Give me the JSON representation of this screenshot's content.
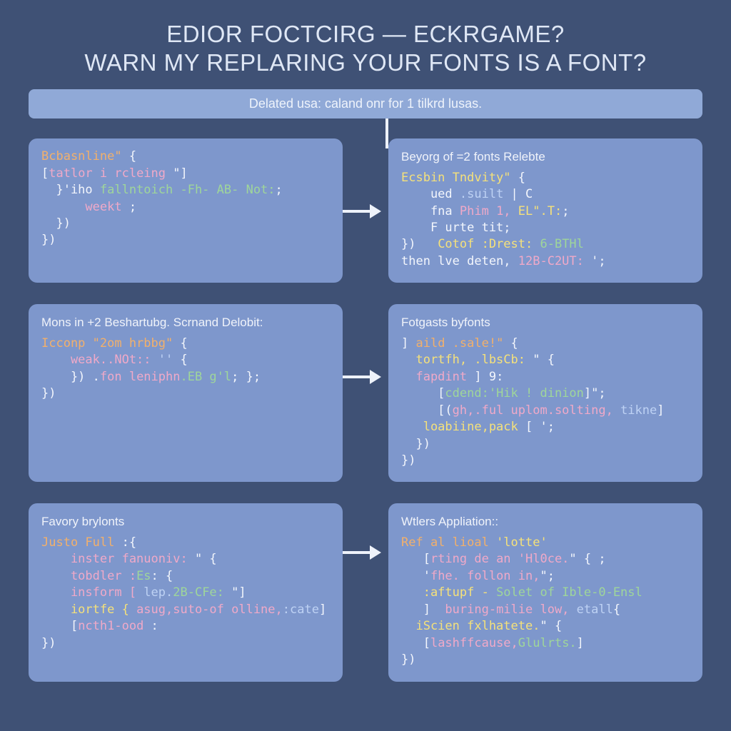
{
  "title": {
    "line1": "EDIOR FOCTCIRG — ECKRGAME?",
    "line2": "WARN MY REPLARING YOUR FONTS IS A FONT?"
  },
  "banner": "Delated usa: caland onr for 1 tilkrd lusas.",
  "cards": [
    {
      "title": "",
      "lines": [
        [
          {
            "c": "o",
            "t": "Bcbasnline\""
          },
          {
            "c": "w",
            "t": " {"
          }
        ],
        [
          {
            "c": "w",
            "t": "["
          },
          {
            "c": "p",
            "t": "tatlor i rcleing"
          },
          {
            "c": "w",
            "t": " \"]"
          }
        ],
        [
          {
            "c": "w",
            "t": "  }'iho "
          },
          {
            "c": "g",
            "t": "fallntoich -Fh- AB- Not:"
          },
          {
            "c": "w",
            "t": ";"
          }
        ],
        [
          {
            "c": "p",
            "t": "      weekt"
          },
          {
            "c": "w",
            "t": " ;"
          }
        ],
        [
          {
            "c": "w",
            "t": "  })"
          }
        ],
        [
          {
            "c": "w",
            "t": "})"
          }
        ]
      ]
    },
    {
      "title": "Beyorg of =2 fonts Relebte",
      "lines": [
        [
          {
            "c": "y",
            "t": "Ecsbin Tndvity\""
          },
          {
            "c": "w",
            "t": " {"
          }
        ],
        [
          {
            "c": "w",
            "t": "    ued "
          },
          {
            "c": "b",
            "t": ".suilt"
          },
          {
            "c": "w",
            "t": " | C"
          }
        ],
        [
          {
            "c": "w",
            "t": "    fna "
          },
          {
            "c": "p",
            "t": "Phim 1,"
          },
          {
            "c": "y",
            "t": " EL\".T:"
          },
          {
            "c": "w",
            "t": ";"
          }
        ],
        [
          {
            "c": "w",
            "t": "    F urte tit;"
          }
        ],
        [
          {
            "c": "w",
            "t": "})   "
          },
          {
            "c": "y",
            "t": "Cotof :Drest:"
          },
          {
            "c": "g",
            "t": " 6-BTHl"
          }
        ],
        [
          {
            "c": "w",
            "t": "then lve deten, "
          },
          {
            "c": "p",
            "t": "12B-C2UT:"
          },
          {
            "c": "w",
            "t": " ';"
          }
        ]
      ]
    },
    {
      "title": "Mons in +2 Beshartubg. Scrnand Delobit:",
      "lines": [
        [
          {
            "c": "o",
            "t": "Icconp \"2om hrbbg\""
          },
          {
            "c": "w",
            "t": " {"
          }
        ],
        [
          {
            "c": "p",
            "t": "    weak..NOt::"
          },
          {
            "c": "b",
            "t": " '' "
          },
          {
            "c": "w",
            "t": "{"
          }
        ],
        [
          {
            "c": "w",
            "t": "    }) ."
          },
          {
            "c": "p",
            "t": "fon leniphn"
          },
          {
            "c": "g",
            "t": ".EB g'l"
          },
          {
            "c": "w",
            "t": "; };"
          }
        ],
        [
          {
            "c": "w",
            "t": "})"
          }
        ]
      ]
    },
    {
      "title": "Fotgasts byfonts",
      "lines": [
        [
          {
            "c": "w",
            "t": "] "
          },
          {
            "c": "o",
            "t": "aild .sale!\""
          },
          {
            "c": "w",
            "t": " {"
          }
        ],
        [
          {
            "c": "y",
            "t": "  tortfh, .lbsCb:"
          },
          {
            "c": "w",
            "t": " \" {"
          }
        ],
        [
          {
            "c": "p",
            "t": "  fapdint"
          },
          {
            "c": "w",
            "t": " ] 9:"
          }
        ],
        [
          {
            "c": "w",
            "t": "     ["
          },
          {
            "c": "g",
            "t": "cdend:'Hik ! dinion"
          },
          {
            "c": "w",
            "t": "]\";"
          }
        ],
        [
          {
            "c": "w",
            "t": "     [("
          },
          {
            "c": "p",
            "t": "gh,.ful uplom.solting,"
          },
          {
            "c": "b",
            "t": " tikne"
          },
          {
            "c": "w",
            "t": "]"
          }
        ],
        [
          {
            "c": "y",
            "t": "   loabiine,pack"
          },
          {
            "c": "w",
            "t": " [ ';"
          }
        ],
        [
          {
            "c": "w",
            "t": "  })"
          }
        ],
        [
          {
            "c": "w",
            "t": "})"
          }
        ]
      ]
    },
    {
      "title": "Favory brylonts",
      "lines": [
        [
          {
            "c": "o",
            "t": "Justo Full"
          },
          {
            "c": "w",
            "t": " :{"
          }
        ],
        [
          {
            "c": "p",
            "t": "    inster fanuoniv:"
          },
          {
            "c": "w",
            "t": " \" {"
          }
        ],
        [
          {
            "c": "p",
            "t": "    tobdler :"
          },
          {
            "c": "g",
            "t": "Es"
          },
          {
            "c": "w",
            "t": ": {"
          }
        ],
        [
          {
            "c": "p",
            "t": "    insform ["
          },
          {
            "c": "b",
            "t": " lep."
          },
          {
            "c": "g",
            "t": "2B-CFe:"
          },
          {
            "c": "w",
            "t": " \"]"
          }
        ],
        [
          {
            "c": "y",
            "t": "    iortfe { "
          },
          {
            "c": "p",
            "t": "asug,suto-of olline,"
          },
          {
            "c": "b",
            "t": ":cate"
          },
          {
            "c": "w",
            "t": "]"
          }
        ],
        [
          {
            "c": "w",
            "t": "    ["
          },
          {
            "c": "p",
            "t": "ncth1-ood"
          },
          {
            "c": "w",
            "t": " :"
          }
        ],
        [
          {
            "c": "w",
            "t": "})"
          }
        ]
      ]
    },
    {
      "title": "Wtlers Appliation::",
      "lines": [
        [
          {
            "c": "o",
            "t": "Ref al lioal "
          },
          {
            "c": "y",
            "t": "'lotte'"
          }
        ],
        [
          {
            "c": "w",
            "t": "   ["
          },
          {
            "c": "p",
            "t": "rting de an 'Hl0ce."
          },
          {
            "c": "w",
            "t": "\" { ;"
          }
        ],
        [
          {
            "c": "w",
            "t": "   '"
          },
          {
            "c": "p",
            "t": "fhe. follon in,"
          },
          {
            "c": "w",
            "t": "\";"
          }
        ],
        [
          {
            "c": "y",
            "t": "   :aftupf -"
          },
          {
            "c": "g",
            "t": " Solet of Ible-0-Ensl"
          }
        ],
        [
          {
            "c": "w",
            "t": "   ]  "
          },
          {
            "c": "p",
            "t": "buring-milie low,"
          },
          {
            "c": "b",
            "t": " etall"
          },
          {
            "c": "w",
            "t": "{"
          }
        ],
        [
          {
            "c": "y",
            "t": "  iScien fxlhatete."
          },
          {
            "c": "w",
            "t": "\" {"
          }
        ],
        [
          {
            "c": "w",
            "t": "   ["
          },
          {
            "c": "p",
            "t": "lashffcause,"
          },
          {
            "c": "g",
            "t": "Glulrts."
          },
          {
            "c": "w",
            "t": "]"
          }
        ],
        [
          {
            "c": "w",
            "t": "})"
          }
        ]
      ]
    }
  ]
}
